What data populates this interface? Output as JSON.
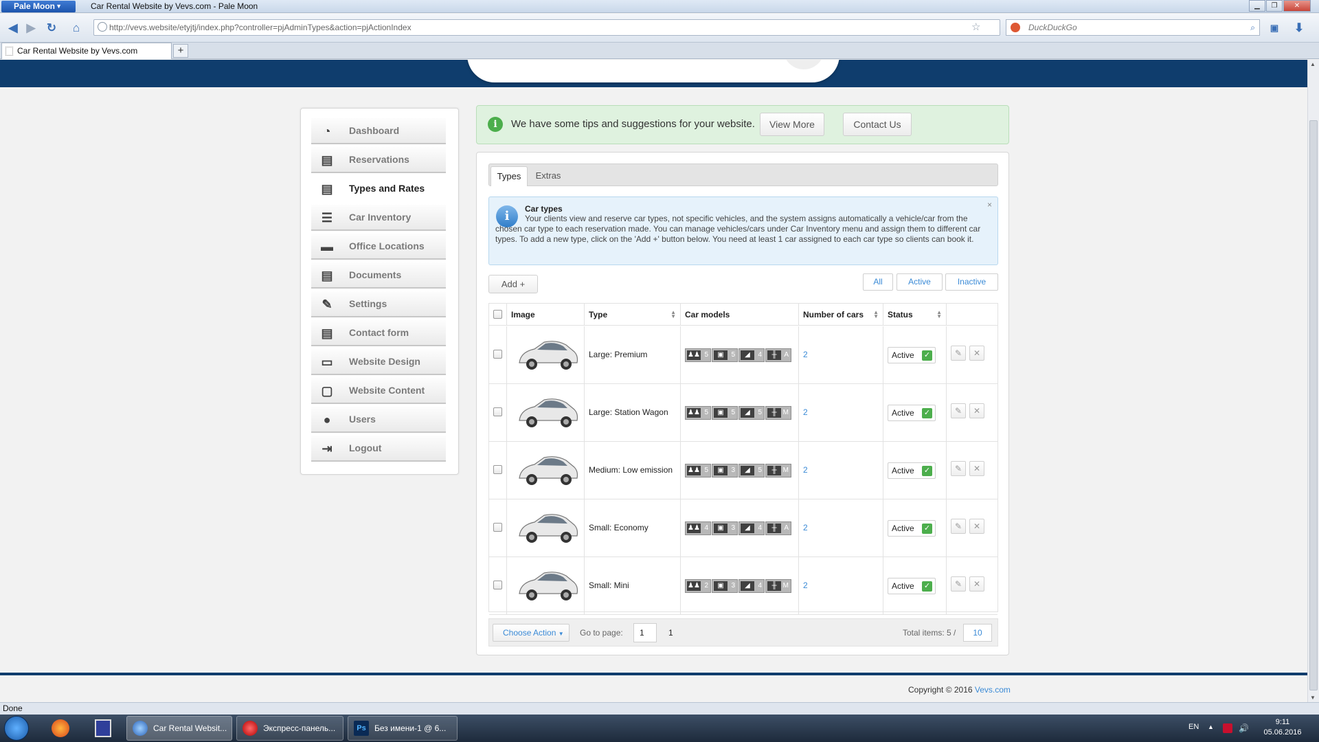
{
  "browser": {
    "app_menu_label": "Pale Moon",
    "window_title": "Car Rental Website by Vevs.com - Pale Moon",
    "url": "http://vevs.website/etyjtj/index.php?controller=pjAdminTypes&action=pjActionIndex",
    "search_engine": "DuckDuckGo",
    "tab_title": "Car Rental Website by Vevs.com",
    "status_text": "Done"
  },
  "sidebar": {
    "items": [
      {
        "label": "Dashboard",
        "icon": "gauge-icon"
      },
      {
        "label": "Reservations",
        "icon": "clipboard-icon"
      },
      {
        "label": "Types and Rates",
        "icon": "document-icon"
      },
      {
        "label": "Car Inventory",
        "icon": "list-icon"
      },
      {
        "label": "Office Locations",
        "icon": "folder-icon"
      },
      {
        "label": "Documents",
        "icon": "document-icon"
      },
      {
        "label": "Settings",
        "icon": "wrench-icon"
      },
      {
        "label": "Contact form",
        "icon": "form-icon"
      },
      {
        "label": "Website Design",
        "icon": "monitor-icon"
      },
      {
        "label": "Website Content",
        "icon": "window-icon"
      },
      {
        "label": "Users",
        "icon": "users-icon"
      },
      {
        "label": "Logout",
        "icon": "logout-icon"
      }
    ],
    "active_index": 2
  },
  "tips": {
    "message": "We have some tips and suggestions for your website.",
    "view_more": "View More",
    "contact_us": "Contact Us"
  },
  "tabs": [
    "Types",
    "Extras"
  ],
  "info": {
    "title": "Car types",
    "body": "Your clients view and reserve car types, not specific vehicles, and the system assigns automatically a vehicle/car from the chosen car type to each reservation made. You can manage vehicles/cars under Car Inventory menu and assign them to different car types. To add a new type, click on the 'Add +' button below. You need at least 1 car assigned to each car type so clients can book it.",
    "close": "×"
  },
  "toolbar": {
    "add_label": "Add +",
    "filters": [
      "All",
      "Active",
      "Inactive"
    ]
  },
  "table": {
    "headers": {
      "image": "Image",
      "type": "Type",
      "models": "Car models",
      "cars": "Number of cars",
      "status": "Status"
    },
    "rows": [
      {
        "type": "Large: Premium",
        "passengers": "5",
        "luggage": "5",
        "doors": "4",
        "transmission": "A",
        "cars": "2",
        "status": "Active"
      },
      {
        "type": "Large: Station Wagon",
        "passengers": "5",
        "luggage": "5",
        "doors": "5",
        "transmission": "M",
        "cars": "2",
        "status": "Active"
      },
      {
        "type": "Medium: Low emission",
        "passengers": "5",
        "luggage": "3",
        "doors": "5",
        "transmission": "M",
        "cars": "2",
        "status": "Active"
      },
      {
        "type": "Small: Economy",
        "passengers": "4",
        "luggage": "3",
        "doors": "4",
        "transmission": "A",
        "cars": "2",
        "status": "Active"
      },
      {
        "type": "Small: Mini",
        "passengers": "2",
        "luggage": "3",
        "doors": "4",
        "transmission": "M",
        "cars": "2",
        "status": "Active"
      }
    ]
  },
  "pager": {
    "choose_action": "Choose Action",
    "goto_label": "Go to page:",
    "page_value": "1",
    "page_count": "1",
    "total_label": "Total items: 5 /",
    "per_page": "10"
  },
  "footer": {
    "copyright": "Copyright © 2016",
    "link": "Vevs.com"
  },
  "taskbar": {
    "tasks": [
      "Car Rental Websit...",
      "Экспресс-панель...",
      "Без имени-1 @ 6..."
    ],
    "lang": "EN",
    "time": "9:11",
    "date": "05.06.2016"
  },
  "colors": {
    "header_navy": "#0f3d6d",
    "link_blue": "#3a8ad6",
    "success_green": "#4cae4c",
    "tips_bg": "#dff2df"
  }
}
